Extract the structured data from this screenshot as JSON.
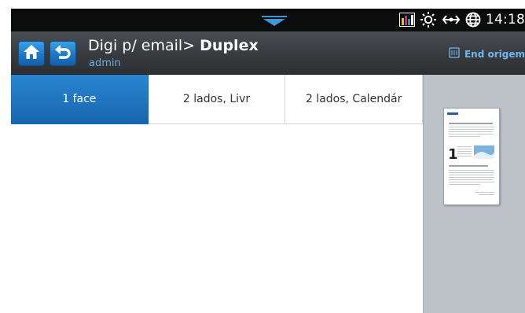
{
  "status_bar": {
    "time": "14:18",
    "icons": [
      "pulldown-arrow-icon",
      "toner-levels-icon",
      "sun-icon",
      "network-icon",
      "globe-icon"
    ]
  },
  "header": {
    "title_prefix": "Digi p/ email> ",
    "title_bold": "Duplex",
    "user": "admin",
    "original_orientation_label": "End origem"
  },
  "tabs": [
    {
      "label": "1 face",
      "selected": true
    },
    {
      "label": "2 lados, Livr",
      "selected": false
    },
    {
      "label": "2 lados, Calendár",
      "selected": false
    }
  ],
  "preview": {
    "thumbnail_text": "1"
  },
  "colors": {
    "accent": "#1d79c8",
    "header": "#3a3d41",
    "link": "#5db2ee",
    "preview_bg": "#bcc2c8"
  }
}
